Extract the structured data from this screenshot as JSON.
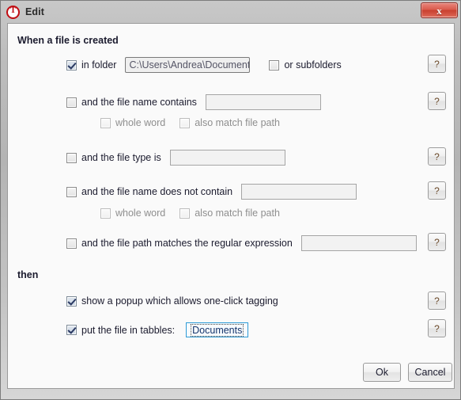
{
  "window": {
    "title": "Edit",
    "app_icon": "tabbles-circle-t-icon",
    "close_label": "x"
  },
  "sections": {
    "when_heading": "When a file is created",
    "then_heading": "then"
  },
  "when_rules": [
    {
      "id": "in-folder",
      "checked": true,
      "enabled": true,
      "label": "in folder",
      "field_value": "C:\\Users\\Andrea\\Documents",
      "extra_checkbox": {
        "label": "or subfolders",
        "checked": false,
        "enabled": true
      },
      "help": "?"
    },
    {
      "id": "file-name-contains",
      "checked": false,
      "enabled": true,
      "label": "and the file name contains",
      "field_value": "",
      "help": "?",
      "sub_options": [
        {
          "label": "whole word",
          "checked": false,
          "enabled": false
        },
        {
          "label": "also match file path",
          "checked": false,
          "enabled": false
        }
      ]
    },
    {
      "id": "file-type-is",
      "checked": false,
      "enabled": true,
      "label": "and the file type is",
      "field_value": "",
      "help": "?"
    },
    {
      "id": "file-name-does-not-contain",
      "checked": false,
      "enabled": true,
      "label": "and the file name does not contain",
      "field_value": "",
      "help": "?",
      "sub_options": [
        {
          "label": "whole word",
          "checked": false,
          "enabled": false
        },
        {
          "label": "also match file path",
          "checked": false,
          "enabled": false
        }
      ]
    },
    {
      "id": "file-path-regex",
      "checked": false,
      "enabled": true,
      "label": "and the file path matches the regular expression",
      "field_value": "",
      "help": "?"
    }
  ],
  "then_rules": [
    {
      "id": "show-popup",
      "checked": true,
      "label": "show a popup which allows one-click tagging",
      "help": "?"
    },
    {
      "id": "put-file-in-tabbles",
      "checked": true,
      "label": "put the file in tabbles:",
      "tag_value": "Documents",
      "help": "?"
    }
  ],
  "footer": {
    "ok_label": "Ok",
    "cancel_label": "Cancel"
  },
  "colors": {
    "accent_blue": "#2e9bd6",
    "close_red": "#c9402f",
    "text": "#1b1b2e",
    "disabled_text": "#8e8e8e"
  }
}
